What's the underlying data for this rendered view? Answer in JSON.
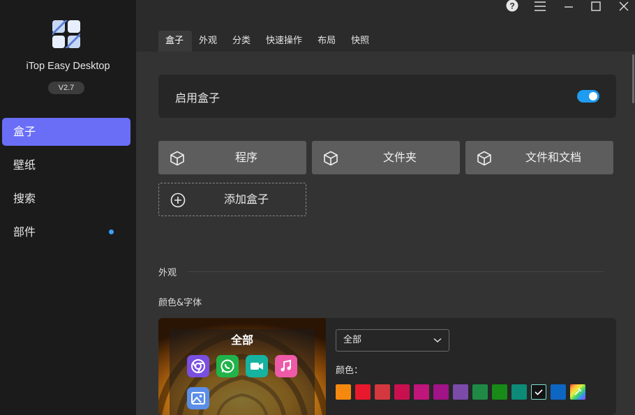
{
  "app": {
    "name": "iTop Easy Desktop",
    "version": "V2.7"
  },
  "sidebar": {
    "items": [
      {
        "label": "盒子",
        "active": true
      },
      {
        "label": "壁纸",
        "active": false
      },
      {
        "label": "搜索",
        "active": false
      },
      {
        "label": "部件",
        "active": false,
        "badge": true
      }
    ]
  },
  "titlebar": {
    "icons": [
      "help-icon",
      "menu-icon",
      "minimize-icon",
      "maximize-icon",
      "close-icon"
    ]
  },
  "tabs": [
    {
      "label": "盒子",
      "active": true
    },
    {
      "label": "外观",
      "active": false
    },
    {
      "label": "分类",
      "active": false
    },
    {
      "label": "快速操作",
      "active": false
    },
    {
      "label": "布局",
      "active": false
    },
    {
      "label": "快照",
      "active": false
    }
  ],
  "enable_box": {
    "label": "启用盒子",
    "enabled": true
  },
  "boxes": [
    {
      "label": "程序"
    },
    {
      "label": "文件夹"
    },
    {
      "label": "文件和文档"
    }
  ],
  "add_box": {
    "label": "添加盒子"
  },
  "appearance_section": {
    "title": "外观",
    "subtitle": "颜色&字体",
    "preview_title": "全部",
    "preview_icons": [
      "chrome-icon",
      "whatsapp-icon",
      "facetime-icon",
      "music-icon",
      "photos-icon"
    ],
    "dropdown_value": "全部",
    "color_label": "颜色：",
    "swatches": [
      "#f5890f",
      "#e8192c",
      "#d4383f",
      "#c8104f",
      "#c0157a",
      "#a01487",
      "#7a4ba8",
      "#1e8a46",
      "#178a17",
      "#0d8a78",
      "#141414",
      "#0d66c2",
      "rainbow"
    ],
    "selected_swatch_index": 10
  },
  "colors": {
    "accent": "#6a6ef7",
    "toggle": "#1f9bf0",
    "sidebar_bg": "#1b1b1b",
    "badge": "#3aa0ff"
  }
}
